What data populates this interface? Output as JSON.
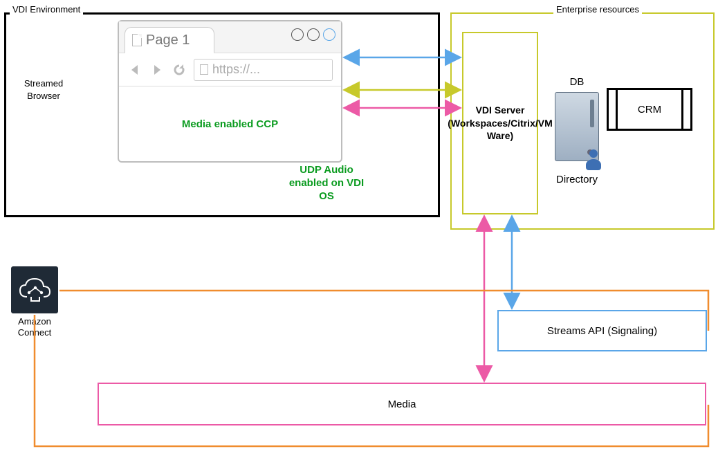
{
  "groups": {
    "vdi_env_title": "VDI Environment",
    "enterprise_title": "Enterprise resources"
  },
  "vdi_env": {
    "streamed_browser_label": "Streamed\nBrowser",
    "browser": {
      "tab_label": "Page 1",
      "address_placeholder": "https://...",
      "ccp_text": "Media enabled CCP"
    },
    "udp_note": "UDP Audio enabled on VDI OS"
  },
  "enterprise": {
    "vdi_server_label": "VDI Server (Workspaces/Citrix/VM Ware)",
    "db_label": "DB",
    "directory_label": "Directory",
    "crm_label": "CRM"
  },
  "amazon_connect_label": "Amazon Connect",
  "streams_api_label": "Streams API (Signaling)",
  "media_label": "Media",
  "arrows": [
    {
      "name": "ccp-to-vdi-blue",
      "color": "#5aa6e8",
      "from": "streamed-browser",
      "to": "vdi-server",
      "bidirectional": true
    },
    {
      "name": "ccp-to-vdi-yellow",
      "color": "#c7c92b",
      "from": "streamed-browser",
      "to": "vdi-server",
      "bidirectional": true
    },
    {
      "name": "ccp-to-vdi-pink",
      "color": "#ec5aa6",
      "from": "streamed-browser",
      "to": "vdi-server",
      "bidirectional": true
    },
    {
      "name": "vdi-to-media-pink",
      "color": "#ec5aa6",
      "from": "vdi-server",
      "to": "media-box",
      "bidirectional": true
    },
    {
      "name": "vdi-to-streams-blue",
      "color": "#5aa6e8",
      "from": "vdi-server",
      "to": "streams-api-box",
      "bidirectional": true
    },
    {
      "name": "aws-to-streams",
      "color": "#f08c2e",
      "from": "amazon-connect",
      "to": "streams-api-box",
      "bidirectional": false
    },
    {
      "name": "aws-to-media",
      "color": "#f08c2e",
      "from": "amazon-connect",
      "to": "media-box",
      "bidirectional": false
    }
  ],
  "colors": {
    "blue": "#5aa6e8",
    "yellow": "#c7c92b",
    "pink": "#ec5aa6",
    "orange": "#f08c2e",
    "green_text": "#0a9b1f",
    "aws_dark": "#1f2a36"
  }
}
